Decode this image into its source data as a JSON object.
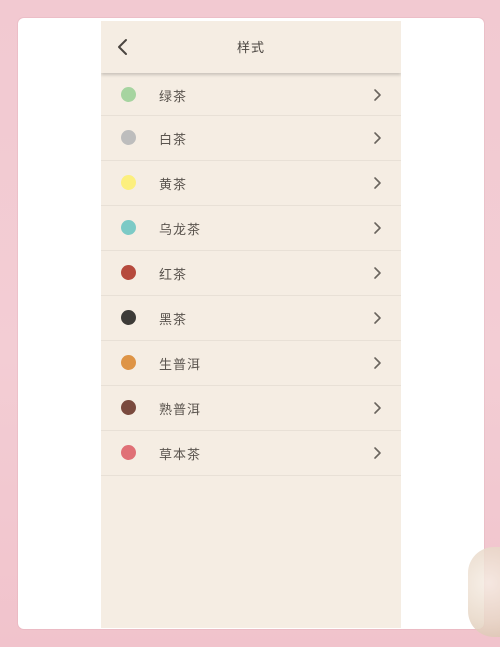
{
  "header": {
    "title": "样式"
  },
  "colors": {
    "background": "#f3cdd4",
    "panel": "#f5ede3"
  },
  "tea_types": [
    {
      "label": "绿茶",
      "color": "#a6d4a0"
    },
    {
      "label": "白茶",
      "color": "#bdbdbd"
    },
    {
      "label": "黄茶",
      "color": "#fcef7e"
    },
    {
      "label": "乌龙茶",
      "color": "#7ccac6"
    },
    {
      "label": "红茶",
      "color": "#b64a3d"
    },
    {
      "label": "黑茶",
      "color": "#3d3b38"
    },
    {
      "label": "生普洱",
      "color": "#de9446"
    },
    {
      "label": "熟普洱",
      "color": "#7a4a3e"
    },
    {
      "label": "草本茶",
      "color": "#e07076"
    }
  ],
  "icons": {
    "back": "chevron-left-icon",
    "row": "chevron-right-icon"
  }
}
